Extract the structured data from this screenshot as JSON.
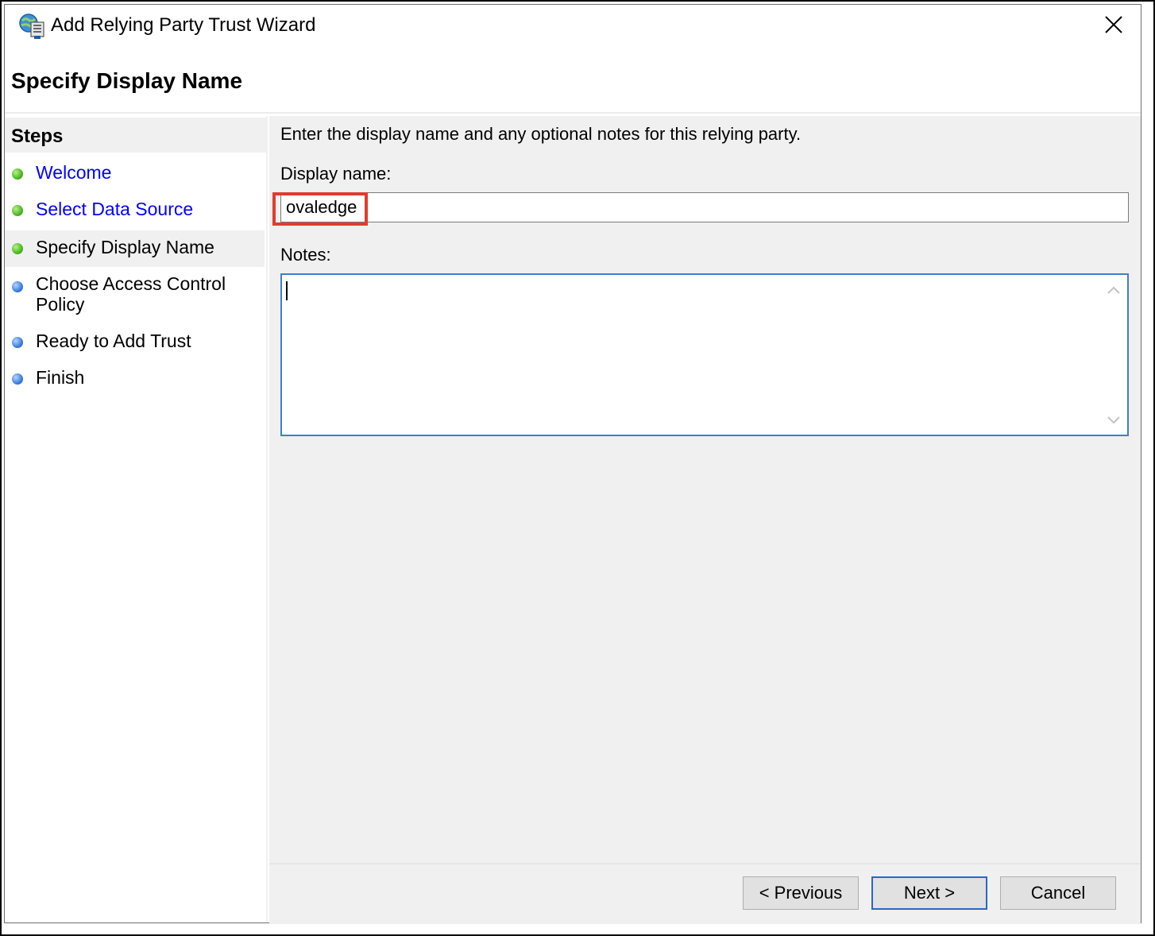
{
  "window": {
    "title": "Add Relying Party Trust Wizard"
  },
  "page": {
    "title": "Specify Display Name"
  },
  "steps": {
    "header": "Steps",
    "items": [
      {
        "label": "Welcome",
        "status": "completed",
        "link": true
      },
      {
        "label": "Select Data Source",
        "status": "completed",
        "link": true
      },
      {
        "label": "Specify Display Name",
        "status": "current",
        "link": false
      },
      {
        "label": "Choose Access Control Policy",
        "status": "pending",
        "link": false
      },
      {
        "label": "Ready to Add Trust",
        "status": "pending",
        "link": false
      },
      {
        "label": "Finish",
        "status": "pending",
        "link": false
      }
    ]
  },
  "form": {
    "instructions": "Enter the display name and any optional notes for this relying party.",
    "display_name_label": "Display name:",
    "display_name_value": "ovaledge",
    "notes_label": "Notes:",
    "notes_value": ""
  },
  "buttons": {
    "previous": "< Previous",
    "next": "Next >",
    "cancel": "Cancel"
  },
  "colors": {
    "highlight": "#e03c2f",
    "link": "#0000ff",
    "focus": "#3c7fd1",
    "completed_step": "#4cb81e",
    "pending_step": "#3b7ee0"
  },
  "icons": {
    "app": "relying-party-wizard-icon",
    "close": "close-icon",
    "scroll_up": "chevron-up-icon",
    "scroll_down": "chevron-down-icon"
  }
}
